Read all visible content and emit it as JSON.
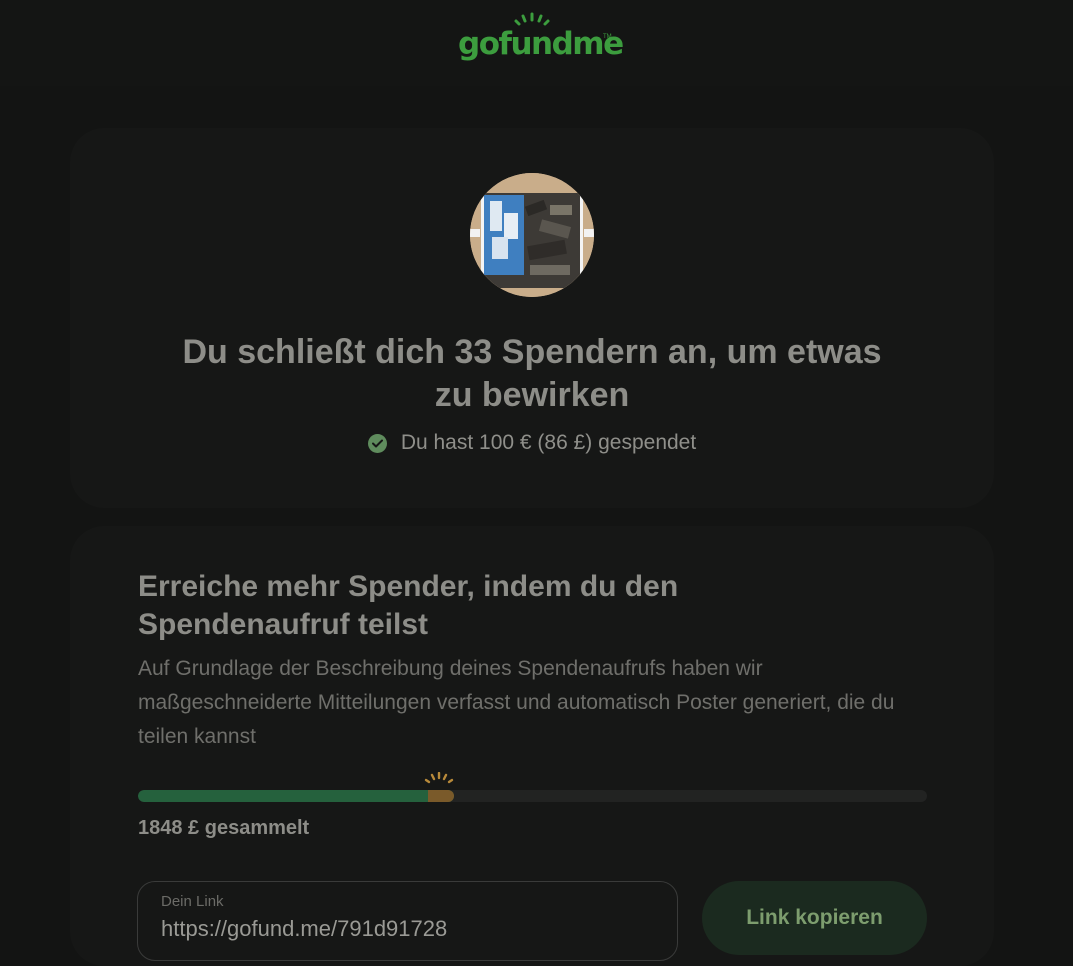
{
  "header": {
    "logo_text": "gofundme",
    "logo_tm": "TM"
  },
  "summary": {
    "title": "Du schließt dich 33 Spendern an, um etwas zu bewirken",
    "donated_text": "Du hast 100 € (86 £) gespendet"
  },
  "share": {
    "title": "Erreiche mehr Spender, indem du den Spendenaufruf teilst",
    "description": "Auf Grundlage der Beschreibung deines Spendenaufrufs haben wir maßgeschneiderte Mitteilungen verfasst und automatisch Poster generiert, die du teilen kannst",
    "progress_fraction": 0.4,
    "raised_text": "1848 £ gesammelt",
    "link_label": "Dein Link",
    "link_value": "https://gofund.me/791d91728",
    "copy_label": "Link kopieren"
  },
  "colors": {
    "brand": "#3c9d3e",
    "progress": "#25613d",
    "progress_tip": "#7a5a2a",
    "check": "#5f8c5d"
  }
}
